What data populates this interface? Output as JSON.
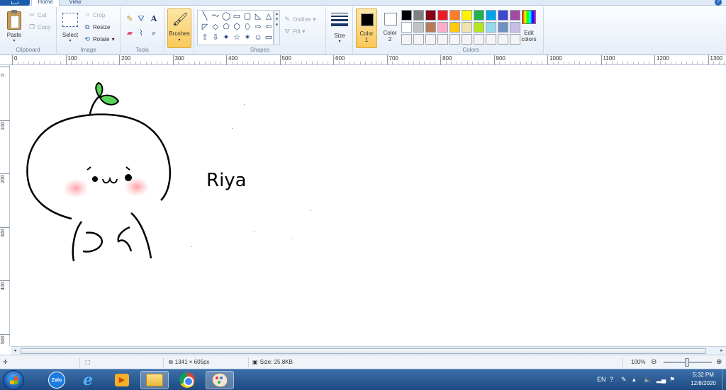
{
  "tabs": {
    "home": "Home",
    "view": "View"
  },
  "ribbon": {
    "clipboard": {
      "label": "Clipboard",
      "paste": "Paste",
      "cut": "Cut",
      "copy": "Copy"
    },
    "image": {
      "label": "Image",
      "select": "Select",
      "crop": "Crop",
      "resize": "Resize",
      "rotate": "Rotate"
    },
    "tools": {
      "label": "Tools"
    },
    "brushes": {
      "label": "Brushes"
    },
    "shapes": {
      "label": "Shapes",
      "outline": "Outline",
      "fill": "Fill",
      "items": [
        "╲",
        "〜",
        "◯",
        "▭",
        "▢",
        "◺",
        "△",
        "◸",
        "◇",
        "⬠",
        "⬡",
        "⬯",
        "⇨",
        "⇦",
        "⇧",
        "⇩",
        "✦",
        "☆",
        "✶",
        "☺",
        "▭"
      ]
    },
    "size": {
      "label": "Size"
    },
    "color1": {
      "label": "Color",
      "num": "1",
      "value": "#000000"
    },
    "color2": {
      "label": "Color",
      "num": "2",
      "value": "#ffffff"
    },
    "colors": {
      "label": "Colors",
      "edit": "Edit",
      "edit2": "colors",
      "palette": [
        "#000000",
        "#7f7f7f",
        "#880015",
        "#ed1c24",
        "#ff7f27",
        "#fff200",
        "#22b14c",
        "#00a2e8",
        "#3f48cc",
        "#a349a4",
        "#ffffff",
        "#c3c3c3",
        "#b97a57",
        "#ffaec9",
        "#ffc90e",
        "#efe4b0",
        "#b5e61d",
        "#99d9ea",
        "#7092be",
        "#c8bfe7",
        "#f4f4f4",
        "#f4f4f4",
        "#f4f4f4",
        "#f4f4f4",
        "#f4f4f4",
        "#f4f4f4",
        "#f4f4f4",
        "#f4f4f4",
        "#f4f4f4",
        "#f4f4f4"
      ]
    }
  },
  "ruler": {
    "h": [
      "0",
      "100",
      "200",
      "300",
      "400",
      "500",
      "600",
      "700",
      "800",
      "900",
      "1000",
      "1100",
      "1200",
      "1300"
    ],
    "v": [
      "0",
      "100",
      "200",
      "300",
      "400",
      "500"
    ]
  },
  "canvas": {
    "text": "Riya"
  },
  "status": {
    "dimensions": "1341 × 605px",
    "size": "Size: 25.8KB",
    "zoom": "100%"
  },
  "taskbar": {
    "zalo": "Zalo"
  },
  "tray": {
    "lang": "EN",
    "time": "5:32 PM",
    "date": "12/8/2020"
  }
}
